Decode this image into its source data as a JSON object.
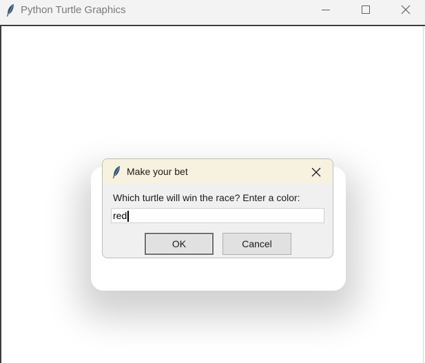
{
  "window": {
    "title": "Python Turtle Graphics",
    "icon": "feather-icon",
    "controls": [
      "minimize-icon",
      "maximize-icon",
      "close-icon"
    ]
  },
  "dialog": {
    "title": "Make your bet",
    "icon": "feather-icon",
    "prompt": "Which turtle will win the race? Enter a color:",
    "input_value": "red",
    "ok_label": "OK",
    "cancel_label": "Cancel"
  },
  "colors": {
    "titlebar": "#f3f3f3",
    "dialog_titlebar": "#f7f1df",
    "dialog_body": "#f0f0f0",
    "button": "#e1e1e1"
  }
}
